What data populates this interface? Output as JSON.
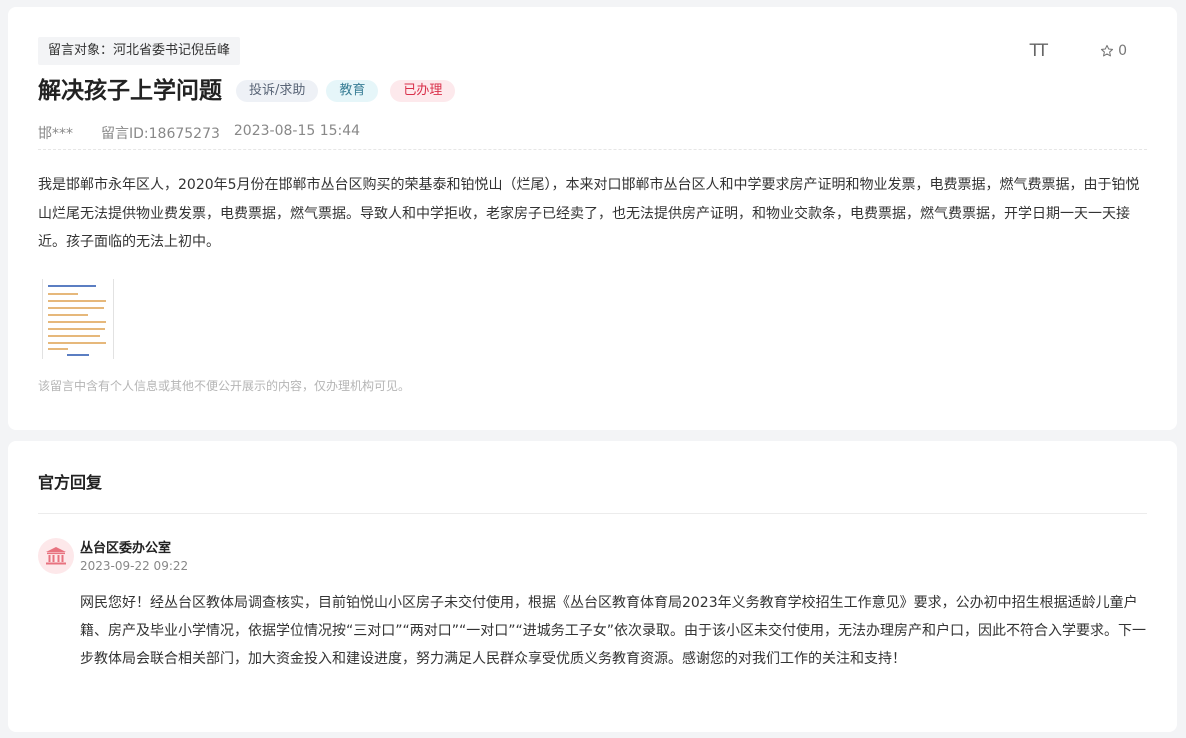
{
  "message": {
    "target": "留言对象：河北省委书记倪岳峰",
    "title": "解决孩子上学问题",
    "tags": {
      "type": "投诉/求助",
      "category": "教育",
      "status": "已办理"
    },
    "author": "邯***",
    "message_id": "留言ID:18675273",
    "datetime": "2023-08-15 15:44",
    "content": "我是邯郸市永年区人，2020年5月份在邯郸市丛台区购买的荣基泰和铂悦山（烂尾），本来对口邯郸市丛台区人和中学要求房产证明和物业发票，电费票据，燃气费票据，由于铂悦山烂尾无法提供物业费发票，电费票据，燃气票据。导致人和中学拒收，老家房子已经卖了，也无法提供房产证明，和物业交款条，电费票据，燃气费票据，开学日期一天一天接近。孩子面临的无法上初中。",
    "privacy_notice": "该留言中含有个人信息或其他不便公开展示的内容，仅办理机构可见。",
    "font_size_label": "TT",
    "favorite_count": "0"
  },
  "reply": {
    "section_title": "官方回复",
    "organization": "丛台区委办公室",
    "datetime": "2023-09-22 09:22",
    "content": "网民您好！经丛台区教体局调查核实，目前铂悦山小区房子未交付使用，根据《丛台区教育体育局2023年义务教育学校招生工作意见》要求，公办初中招生根据适龄儿童户籍、房产及毕业小学情况，依据学位情况按“三对口”“两对口”“一对口”“进城务工子女”依次录取。由于该小区未交付使用，无法办理房产和户口，因此不符合入学要求。下一步教体局会联合相关部门，加大资金投入和建设进度，努力满足人民群众享受优质义务教育资源。感谢您的对我们工作的关注和支持！"
  },
  "icons": {
    "font_size": "font-size-icon",
    "favorite": "star-outline-icon",
    "organization": "government-building-icon"
  },
  "colors": {
    "status_tag": "#d9304a",
    "category_tag": "#3a7f96",
    "avatar_icon": "#e8727f"
  }
}
